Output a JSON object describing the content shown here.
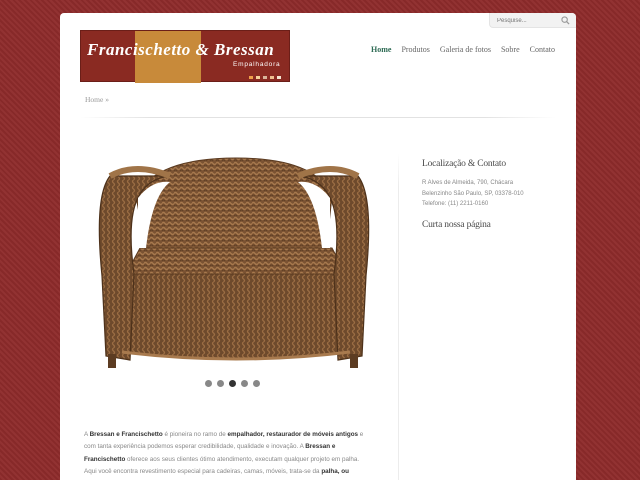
{
  "search": {
    "placeholder": "Pesquise..."
  },
  "logo": {
    "title": "Francischetto & Bressan",
    "subtitle": "Empalhadora",
    "dot_colors": [
      "#f0a04a",
      "#f5d09a",
      "#d8b49a",
      "#f0c090",
      "#f6e6d2"
    ]
  },
  "nav": {
    "items": [
      {
        "label": "Home",
        "active": true
      },
      {
        "label": "Produtos",
        "active": false
      },
      {
        "label": "Galeria de fotos",
        "active": false
      },
      {
        "label": "Sobre",
        "active": false
      },
      {
        "label": "Contato",
        "active": false
      }
    ]
  },
  "breadcrumb": {
    "home": "Home",
    "separator": "»"
  },
  "slider": {
    "count": 5,
    "active_index": 2
  },
  "sidebar": {
    "location_title": "Localização & Contato",
    "address_line1": "R Alves de Almeida, 790, Chácara",
    "address_line2": "Belenzinho São Paulo, SP, 03378-010",
    "phone": "Telefone: (11) 2211-0160",
    "like_title": "Curta nossa página"
  },
  "body": {
    "l1_a": "A ",
    "l1_b": "Bressan e Francischetto",
    "l1_c": " é pioneira no ramo de ",
    "l1_d": "empalhador, restaurador de móveis antigos",
    "l1_e": " e",
    "l2_a": "com tanta experiência podemos esperar credibilidade, qualidade e inovação. A ",
    "l2_b": "Bressan e",
    "l3_a": "Francischetto",
    "l3_b": " oferece aos seus clientes ótimo atendimento, executam qualquer projeto em palha.",
    "l4_a": "Aqui você encontra revestimento especial para cadeiras, camas, móveis, trata-se da ",
    "l4_b": "palha, ou"
  },
  "colors": {
    "background": "#8e2b2b",
    "accent": "#2e6b54"
  }
}
